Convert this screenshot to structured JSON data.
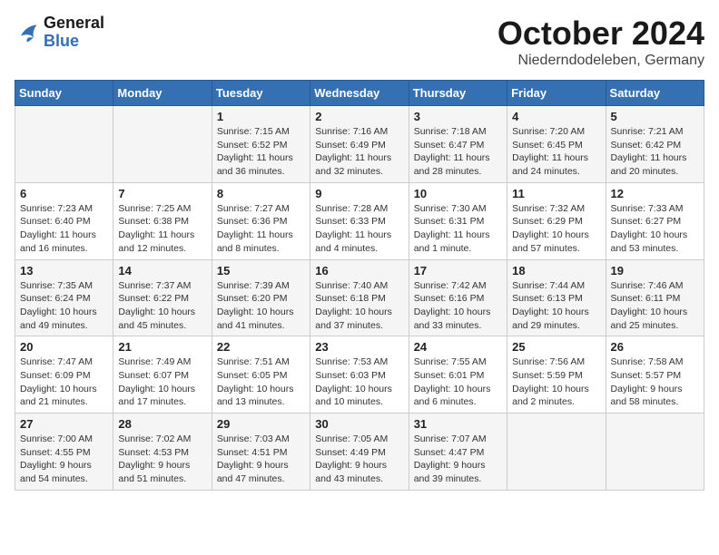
{
  "logo": {
    "line1": "General",
    "line2": "Blue"
  },
  "title": "October 2024",
  "location": "Niederndodeleben, Germany",
  "days_header": [
    "Sunday",
    "Monday",
    "Tuesday",
    "Wednesday",
    "Thursday",
    "Friday",
    "Saturday"
  ],
  "weeks": [
    [
      {
        "day": "",
        "detail": ""
      },
      {
        "day": "",
        "detail": ""
      },
      {
        "day": "1",
        "detail": "Sunrise: 7:15 AM\nSunset: 6:52 PM\nDaylight: 11 hours\nand 36 minutes."
      },
      {
        "day": "2",
        "detail": "Sunrise: 7:16 AM\nSunset: 6:49 PM\nDaylight: 11 hours\nand 32 minutes."
      },
      {
        "day": "3",
        "detail": "Sunrise: 7:18 AM\nSunset: 6:47 PM\nDaylight: 11 hours\nand 28 minutes."
      },
      {
        "day": "4",
        "detail": "Sunrise: 7:20 AM\nSunset: 6:45 PM\nDaylight: 11 hours\nand 24 minutes."
      },
      {
        "day": "5",
        "detail": "Sunrise: 7:21 AM\nSunset: 6:42 PM\nDaylight: 11 hours\nand 20 minutes."
      }
    ],
    [
      {
        "day": "6",
        "detail": "Sunrise: 7:23 AM\nSunset: 6:40 PM\nDaylight: 11 hours\nand 16 minutes."
      },
      {
        "day": "7",
        "detail": "Sunrise: 7:25 AM\nSunset: 6:38 PM\nDaylight: 11 hours\nand 12 minutes."
      },
      {
        "day": "8",
        "detail": "Sunrise: 7:27 AM\nSunset: 6:36 PM\nDaylight: 11 hours\nand 8 minutes."
      },
      {
        "day": "9",
        "detail": "Sunrise: 7:28 AM\nSunset: 6:33 PM\nDaylight: 11 hours\nand 4 minutes."
      },
      {
        "day": "10",
        "detail": "Sunrise: 7:30 AM\nSunset: 6:31 PM\nDaylight: 11 hours\nand 1 minute."
      },
      {
        "day": "11",
        "detail": "Sunrise: 7:32 AM\nSunset: 6:29 PM\nDaylight: 10 hours\nand 57 minutes."
      },
      {
        "day": "12",
        "detail": "Sunrise: 7:33 AM\nSunset: 6:27 PM\nDaylight: 10 hours\nand 53 minutes."
      }
    ],
    [
      {
        "day": "13",
        "detail": "Sunrise: 7:35 AM\nSunset: 6:24 PM\nDaylight: 10 hours\nand 49 minutes."
      },
      {
        "day": "14",
        "detail": "Sunrise: 7:37 AM\nSunset: 6:22 PM\nDaylight: 10 hours\nand 45 minutes."
      },
      {
        "day": "15",
        "detail": "Sunrise: 7:39 AM\nSunset: 6:20 PM\nDaylight: 10 hours\nand 41 minutes."
      },
      {
        "day": "16",
        "detail": "Sunrise: 7:40 AM\nSunset: 6:18 PM\nDaylight: 10 hours\nand 37 minutes."
      },
      {
        "day": "17",
        "detail": "Sunrise: 7:42 AM\nSunset: 6:16 PM\nDaylight: 10 hours\nand 33 minutes."
      },
      {
        "day": "18",
        "detail": "Sunrise: 7:44 AM\nSunset: 6:13 PM\nDaylight: 10 hours\nand 29 minutes."
      },
      {
        "day": "19",
        "detail": "Sunrise: 7:46 AM\nSunset: 6:11 PM\nDaylight: 10 hours\nand 25 minutes."
      }
    ],
    [
      {
        "day": "20",
        "detail": "Sunrise: 7:47 AM\nSunset: 6:09 PM\nDaylight: 10 hours\nand 21 minutes."
      },
      {
        "day": "21",
        "detail": "Sunrise: 7:49 AM\nSunset: 6:07 PM\nDaylight: 10 hours\nand 17 minutes."
      },
      {
        "day": "22",
        "detail": "Sunrise: 7:51 AM\nSunset: 6:05 PM\nDaylight: 10 hours\nand 13 minutes."
      },
      {
        "day": "23",
        "detail": "Sunrise: 7:53 AM\nSunset: 6:03 PM\nDaylight: 10 hours\nand 10 minutes."
      },
      {
        "day": "24",
        "detail": "Sunrise: 7:55 AM\nSunset: 6:01 PM\nDaylight: 10 hours\nand 6 minutes."
      },
      {
        "day": "25",
        "detail": "Sunrise: 7:56 AM\nSunset: 5:59 PM\nDaylight: 10 hours\nand 2 minutes."
      },
      {
        "day": "26",
        "detail": "Sunrise: 7:58 AM\nSunset: 5:57 PM\nDaylight: 9 hours\nand 58 minutes."
      }
    ],
    [
      {
        "day": "27",
        "detail": "Sunrise: 7:00 AM\nSunset: 4:55 PM\nDaylight: 9 hours\nand 54 minutes."
      },
      {
        "day": "28",
        "detail": "Sunrise: 7:02 AM\nSunset: 4:53 PM\nDaylight: 9 hours\nand 51 minutes."
      },
      {
        "day": "29",
        "detail": "Sunrise: 7:03 AM\nSunset: 4:51 PM\nDaylight: 9 hours\nand 47 minutes."
      },
      {
        "day": "30",
        "detail": "Sunrise: 7:05 AM\nSunset: 4:49 PM\nDaylight: 9 hours\nand 43 minutes."
      },
      {
        "day": "31",
        "detail": "Sunrise: 7:07 AM\nSunset: 4:47 PM\nDaylight: 9 hours\nand 39 minutes."
      },
      {
        "day": "",
        "detail": ""
      },
      {
        "day": "",
        "detail": ""
      }
    ]
  ]
}
